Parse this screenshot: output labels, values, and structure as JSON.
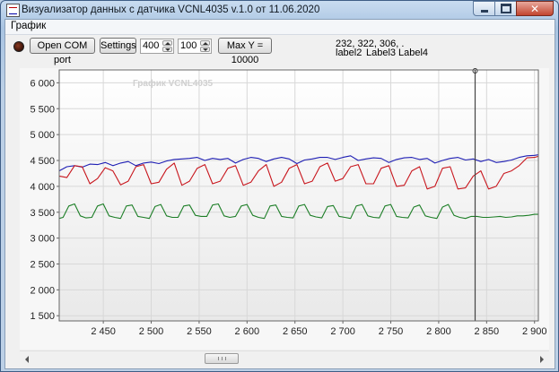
{
  "window": {
    "title": "Визуализатор данных с датчика VCNL4035 v.1.0 от 11.06.2020",
    "close_glyph": "✕"
  },
  "menu": {
    "items": [
      "График"
    ]
  },
  "toolbar": {
    "open_com_label": "Open COM port",
    "settings_label": "Settings",
    "value_a": "400",
    "value_b": "100",
    "maxy_label": "Max Y = 10000"
  },
  "readout": {
    "values": "232, 322, 306, .",
    "label2": "label2",
    "label3": "Label3",
    "label4": "Label4"
  },
  "colors": {
    "series_red": "#c8161d",
    "series_green": "#1c7e26",
    "series_blue": "#1e1eb4"
  },
  "chart_data": {
    "type": "line",
    "title": "График VCNL4035",
    "xlim": [
      2404,
      2904
    ],
    "ylim": [
      1400,
      6250
    ],
    "x_ticks": [
      2450,
      2500,
      2550,
      2600,
      2650,
      2700,
      2750,
      2800,
      2850,
      2900
    ],
    "x_tick_labels": [
      "2 450",
      "2 500",
      "2 550",
      "2 600",
      "2 650",
      "2 700",
      "2 750",
      "2 800",
      "2 850",
      "2 900"
    ],
    "y_ticks": [
      1500,
      2000,
      2500,
      3000,
      3500,
      4000,
      4500,
      5000,
      5500,
      6000
    ],
    "y_tick_labels": [
      "1 500",
      "2 000",
      "2 500",
      "3 000",
      "3 500",
      "4 000",
      "4 500",
      "5 000",
      "5 500",
      "6 000"
    ],
    "grid": true,
    "cursor_x": 2838,
    "series": [
      {
        "color": "#1e1eb4",
        "x": [
          2404,
          2412,
          2420,
          2428,
          2436,
          2444,
          2452,
          2460,
          2468,
          2476,
          2484,
          2492,
          2500,
          2508,
          2516,
          2524,
          2532,
          2540,
          2548,
          2556,
          2564,
          2572,
          2580,
          2588,
          2596,
          2604,
          2612,
          2620,
          2628,
          2636,
          2644,
          2652,
          2660,
          2668,
          2676,
          2684,
          2692,
          2700,
          2708,
          2716,
          2724,
          2732,
          2740,
          2748,
          2756,
          2764,
          2772,
          2780,
          2788,
          2796,
          2804,
          2812,
          2820,
          2828,
          2836,
          2844,
          2852,
          2860,
          2868,
          2876,
          2884,
          2892,
          2900,
          2904
        ],
        "y": [
          4300,
          4380,
          4400,
          4370,
          4430,
          4420,
          4460,
          4400,
          4450,
          4480,
          4400,
          4450,
          4470,
          4440,
          4490,
          4520,
          4530,
          4540,
          4560,
          4500,
          4540,
          4520,
          4540,
          4450,
          4520,
          4560,
          4540,
          4480,
          4530,
          4560,
          4530,
          4440,
          4510,
          4530,
          4560,
          4560,
          4520,
          4560,
          4590,
          4500,
          4530,
          4550,
          4540,
          4460,
          4520,
          4550,
          4560,
          4520,
          4540,
          4450,
          4500,
          4540,
          4560,
          4510,
          4530,
          4480,
          4520,
          4460,
          4480,
          4510,
          4560,
          4590,
          4600,
          4610
        ]
      },
      {
        "color": "#c8161d",
        "x": [
          2404,
          2412,
          2420,
          2428,
          2436,
          2444,
          2452,
          2460,
          2468,
          2476,
          2484,
          2492,
          2500,
          2508,
          2516,
          2524,
          2532,
          2540,
          2548,
          2556,
          2564,
          2572,
          2580,
          2588,
          2596,
          2604,
          2612,
          2620,
          2628,
          2636,
          2644,
          2652,
          2660,
          2668,
          2676,
          2684,
          2692,
          2700,
          2708,
          2716,
          2724,
          2732,
          2740,
          2748,
          2756,
          2764,
          2772,
          2780,
          2788,
          2796,
          2804,
          2812,
          2820,
          2828,
          2836,
          2844,
          2852,
          2860,
          2868,
          2876,
          2884,
          2892,
          2900,
          2904
        ],
        "y": [
          4200,
          4170,
          4400,
          4380,
          4050,
          4150,
          4360,
          4300,
          4030,
          4100,
          4380,
          4420,
          4050,
          4080,
          4330,
          4450,
          4020,
          4100,
          4350,
          4420,
          4050,
          4100,
          4350,
          4400,
          4020,
          4080,
          4300,
          4420,
          4000,
          4080,
          4350,
          4420,
          4050,
          4100,
          4380,
          4450,
          4100,
          4150,
          4380,
          4420,
          4050,
          4050,
          4350,
          4400,
          4000,
          4020,
          4300,
          4380,
          3950,
          4000,
          4350,
          4380,
          3950,
          3970,
          4200,
          4300,
          3950,
          4000,
          4250,
          4300,
          4400,
          4550,
          4560,
          4580
        ]
      },
      {
        "color": "#1c7e26",
        "x": [
          2404,
          2408,
          2414,
          2420,
          2426,
          2432,
          2438,
          2444,
          2450,
          2456,
          2462,
          2468,
          2474,
          2480,
          2486,
          2492,
          2498,
          2504,
          2510,
          2516,
          2522,
          2528,
          2534,
          2540,
          2546,
          2552,
          2558,
          2564,
          2570,
          2576,
          2582,
          2588,
          2594,
          2600,
          2606,
          2612,
          2618,
          2624,
          2630,
          2636,
          2642,
          2648,
          2654,
          2660,
          2666,
          2672,
          2678,
          2684,
          2690,
          2696,
          2702,
          2708,
          2714,
          2720,
          2726,
          2732,
          2738,
          2744,
          2750,
          2756,
          2762,
          2768,
          2774,
          2780,
          2786,
          2792,
          2798,
          2804,
          2810,
          2816,
          2822,
          2828,
          2834,
          2840,
          2846,
          2852,
          2858,
          2864,
          2870,
          2876,
          2882,
          2888,
          2894,
          2900,
          2904
        ],
        "y": [
          3380,
          3400,
          3620,
          3660,
          3430,
          3390,
          3400,
          3620,
          3660,
          3430,
          3400,
          3380,
          3620,
          3640,
          3420,
          3400,
          3380,
          3610,
          3650,
          3430,
          3400,
          3400,
          3620,
          3640,
          3440,
          3420,
          3420,
          3640,
          3660,
          3430,
          3400,
          3420,
          3620,
          3650,
          3440,
          3400,
          3380,
          3620,
          3640,
          3420,
          3400,
          3390,
          3620,
          3650,
          3440,
          3410,
          3390,
          3610,
          3630,
          3420,
          3400,
          3380,
          3620,
          3650,
          3430,
          3400,
          3390,
          3620,
          3650,
          3420,
          3400,
          3390,
          3600,
          3640,
          3430,
          3400,
          3380,
          3600,
          3650,
          3440,
          3400,
          3380,
          3420,
          3420,
          3400,
          3400,
          3410,
          3420,
          3400,
          3410,
          3430,
          3430,
          3440,
          3460,
          3460
        ]
      }
    ]
  }
}
